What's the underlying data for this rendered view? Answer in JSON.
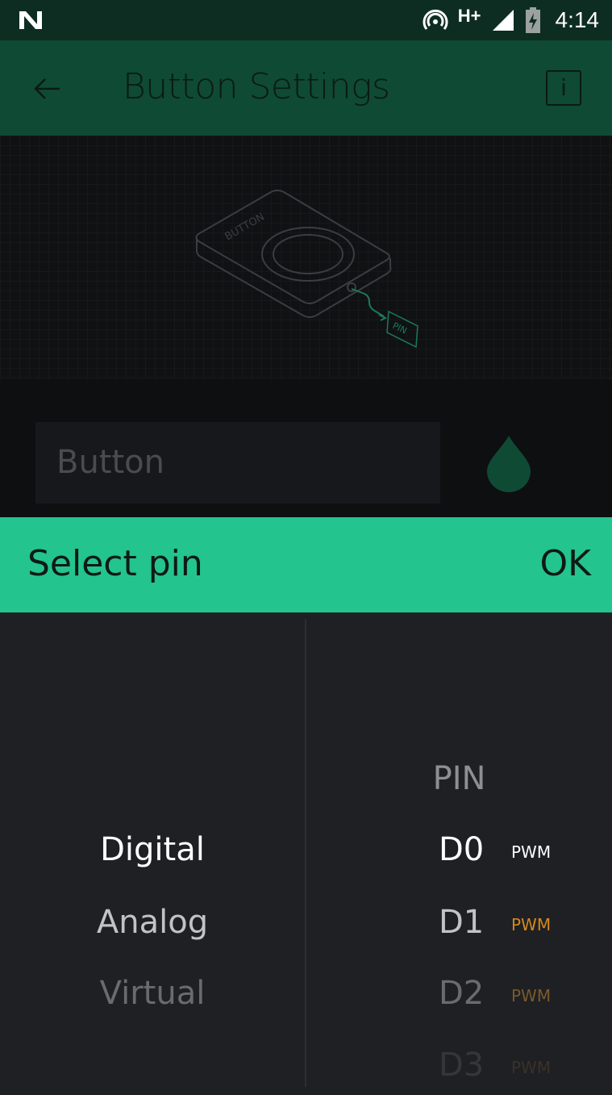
{
  "status_bar": {
    "network_type": "H+",
    "time": "4:14"
  },
  "app_bar": {
    "title": "Button Settings",
    "info_label": "i"
  },
  "illustration": {
    "device_label": "BUTTON",
    "pin_label": "PIN"
  },
  "form": {
    "name_placeholder": "Button",
    "accent_color": "#0f4a35"
  },
  "select_bar": {
    "title": "Select pin",
    "ok_label": "OK",
    "color": "#23c48e"
  },
  "picker": {
    "types": [
      "Digital",
      "Analog",
      "Virtual"
    ],
    "pin_header": "PIN",
    "pins": [
      {
        "name": "D0",
        "tag": "PWM"
      },
      {
        "name": "D1",
        "tag": "PWM"
      },
      {
        "name": "D2",
        "tag": "PWM"
      },
      {
        "name": "D3",
        "tag": "PWM"
      }
    ]
  }
}
